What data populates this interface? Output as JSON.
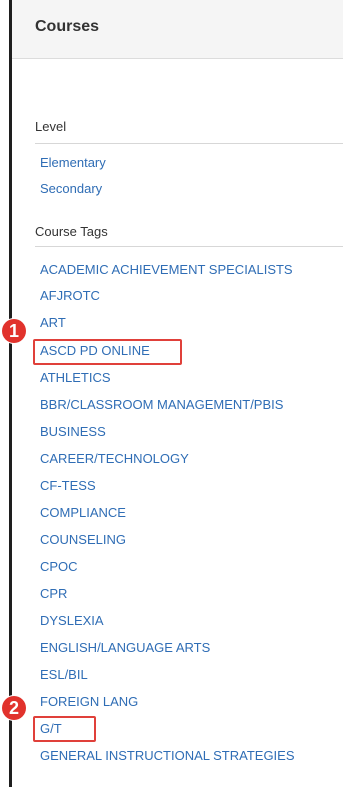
{
  "header": {
    "title": "Courses"
  },
  "level": {
    "title": "Level",
    "items": [
      "Elementary",
      "Secondary"
    ]
  },
  "tags": {
    "title": "Course Tags",
    "items": [
      "ACADEMIC ACHIEVEMENT SPECIALISTS",
      "AFJROTC",
      "ART",
      "ASCD PD ONLINE",
      "ATHLETICS",
      "BBR/CLASSROOM MANAGEMENT/PBIS",
      "BUSINESS",
      "CAREER/TECHNOLOGY",
      "CF-TESS",
      "COMPLIANCE",
      "COUNSELING",
      "CPOC",
      "CPR",
      "DYSLEXIA",
      "ENGLISH/LANGUAGE ARTS",
      "ESL/BIL",
      "FOREIGN LANG",
      "G/T",
      "GENERAL INSTRUCTIONAL STRATEGIES"
    ]
  },
  "callouts": [
    "1",
    "2"
  ],
  "colors": {
    "link": "#2f6db5",
    "callout": "#e1322c"
  }
}
